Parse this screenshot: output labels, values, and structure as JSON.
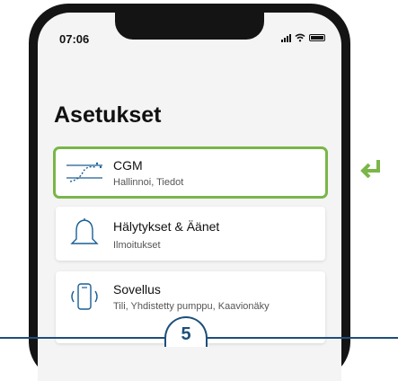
{
  "status_bar": {
    "time": "07:06"
  },
  "page": {
    "title": "Asetukset"
  },
  "menu": [
    {
      "title": "CGM",
      "subtitle": "Hallinnoi, Tiedot",
      "icon": "cgm-trend-icon"
    },
    {
      "title": "Hälytykset & Äänet",
      "subtitle": "Ilmoitukset",
      "icon": "bell-icon"
    },
    {
      "title": "Sovellus",
      "subtitle": "Tili, Yhdistetty pumppu, Kaavionäky",
      "icon": "phone-signal-icon"
    }
  ],
  "step": {
    "number": "5"
  },
  "colors": {
    "highlight": "#7ab648",
    "step_accent": "#1d4f7a",
    "icon_blue": "#1a5e94"
  }
}
